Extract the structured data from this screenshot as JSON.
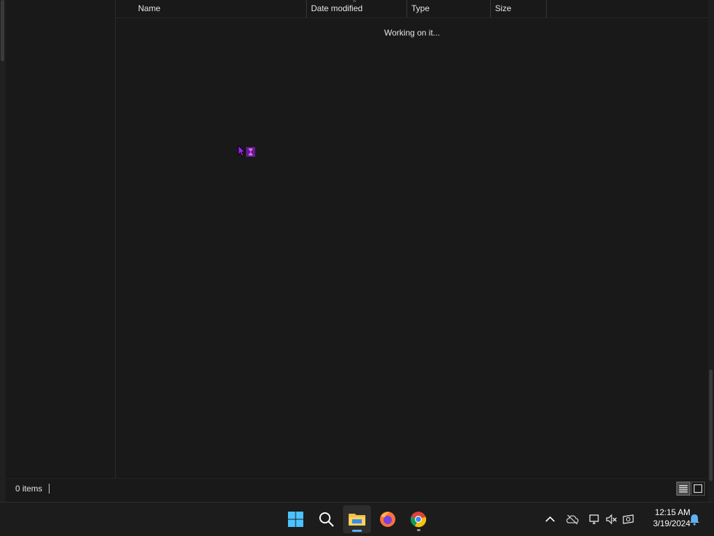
{
  "columns": {
    "name": "Name",
    "date_modified": "Date modified",
    "type": "Type",
    "size": "Size"
  },
  "content": {
    "loading_message": "Working on it..."
  },
  "status_bar": {
    "item_count": "0 items"
  },
  "taskbar": {
    "apps": [
      {
        "name": "start-icon"
      },
      {
        "name": "search-icon"
      },
      {
        "name": "file-explorer-icon",
        "active": true
      },
      {
        "name": "firefox-icon"
      },
      {
        "name": "chrome-icon"
      }
    ],
    "tray": {
      "time": "12:15 AM",
      "date": "3/19/2024"
    }
  },
  "colors": {
    "accent": "#5fb2f2",
    "background": "#191919",
    "cursor": "#a020f0"
  }
}
